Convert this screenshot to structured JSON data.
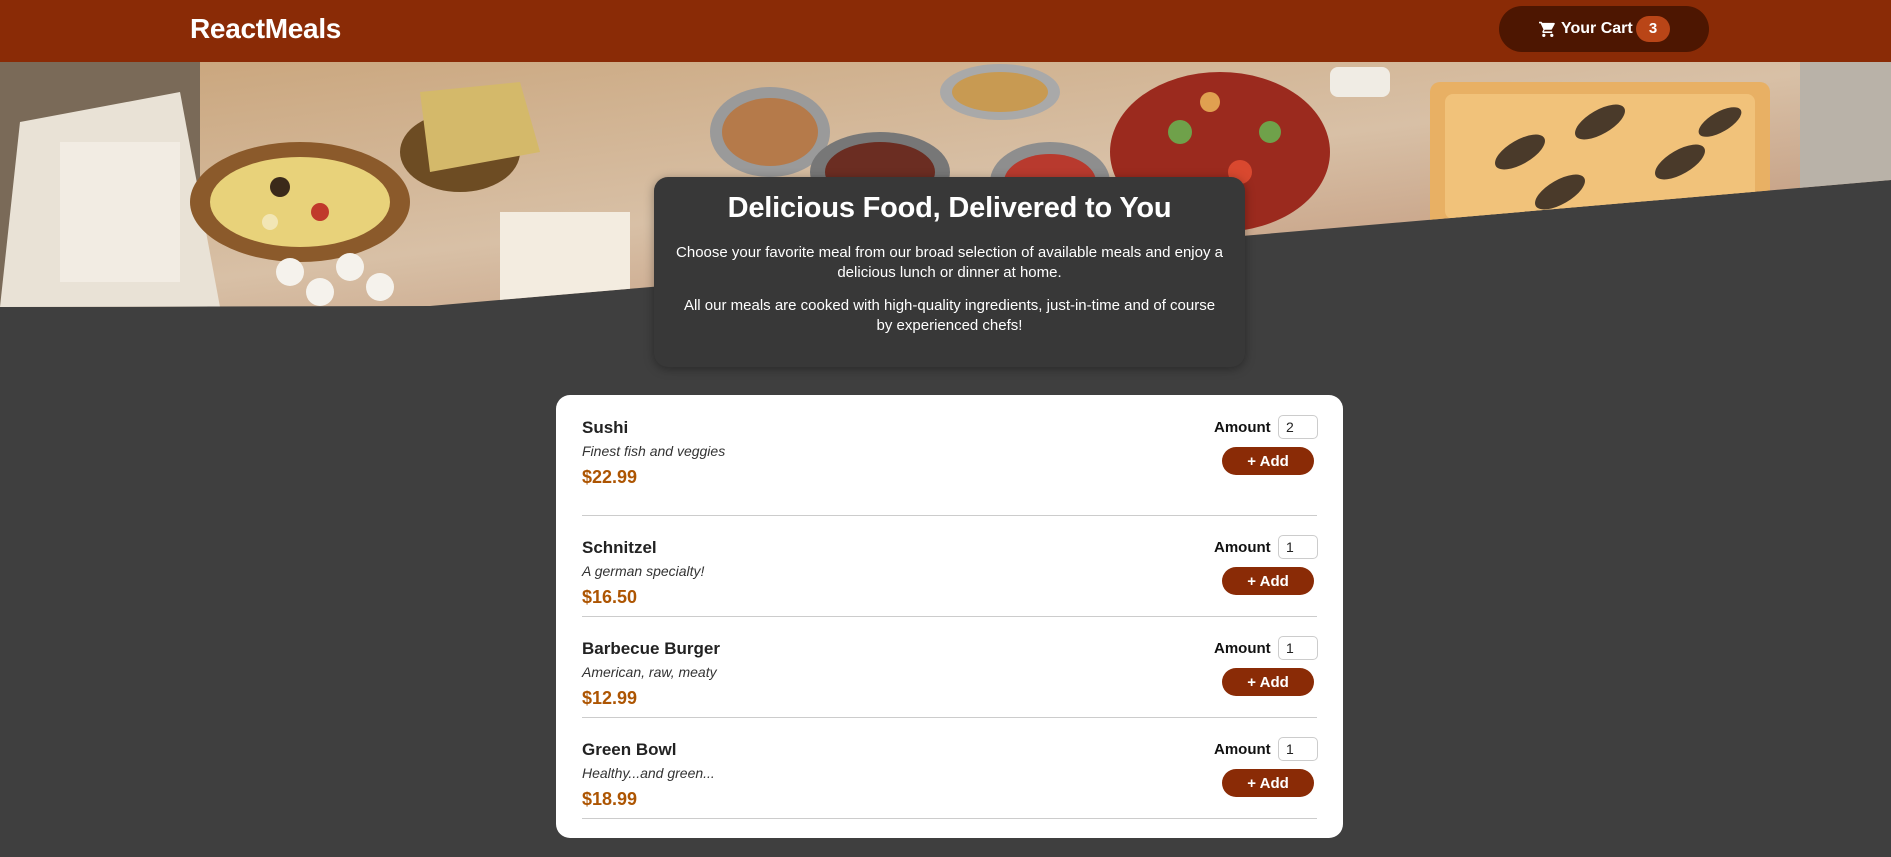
{
  "header": {
    "logo": "ReactMeals",
    "cart_label": "Your Cart",
    "cart_count": "3",
    "cart_icon": "shopping-cart-icon"
  },
  "summary": {
    "title": "Delicious Food, Delivered to You",
    "paragraph1": "Choose your favorite meal from our broad selection of available meals and enjoy a delicious lunch or dinner at home.",
    "paragraph2": "All our meals are cooked with high-quality ingredients, just-in-time and of course by experienced chefs!"
  },
  "meals": [
    {
      "name": "Sushi",
      "description": "Finest fish and veggies",
      "price": "$22.99",
      "amount_label": "Amount",
      "amount": "2",
      "add_label": "+ Add"
    },
    {
      "name": "Schnitzel",
      "description": "A german specialty!",
      "price": "$16.50",
      "amount_label": "Amount",
      "amount": "1",
      "add_label": "+ Add"
    },
    {
      "name": "Barbecue Burger",
      "description": "American, raw, meaty",
      "price": "$12.99",
      "amount_label": "Amount",
      "amount": "1",
      "add_label": "+ Add"
    },
    {
      "name": "Green Bowl",
      "description": "Healthy...and green...",
      "price": "$18.99",
      "amount_label": "Amount",
      "amount": "1",
      "add_label": "+ Add"
    }
  ],
  "colors": {
    "header": "#8a2b06",
    "cart_button": "#4d1601",
    "badge": "#b94517",
    "background": "#3f3f3f",
    "price": "#ad5502"
  }
}
